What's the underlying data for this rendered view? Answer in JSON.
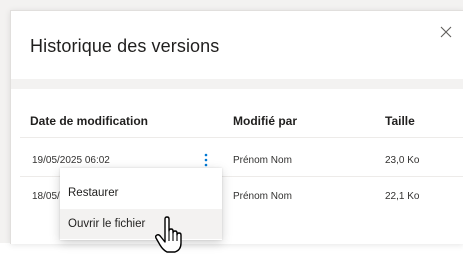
{
  "dialog": {
    "title": "Historique des versions",
    "close_icon": "close-icon"
  },
  "table": {
    "columns": [
      "Date de modification",
      "Modifié par",
      "Taille"
    ],
    "rows": [
      {
        "date": "19/05/2025 06:02",
        "modified_by": "Prénom Nom",
        "size": "23,0 Ko"
      },
      {
        "date": "18/05/",
        "modified_by": "Prénom Nom",
        "size": "22,1 Ko"
      }
    ]
  },
  "context_menu": {
    "items": [
      "Restaurer",
      "Ouvrir le fichier"
    ],
    "highlighted_index": 1
  },
  "colors": {
    "text": "#201f1e",
    "band": "#f3f2f1",
    "divider": "#edebe9",
    "hover": "#f3f2f1",
    "more_icon": "#0078d4"
  },
  "icons": [
    "close-icon",
    "more-vertical-icon",
    "hand-pointer-cursor-icon"
  ]
}
